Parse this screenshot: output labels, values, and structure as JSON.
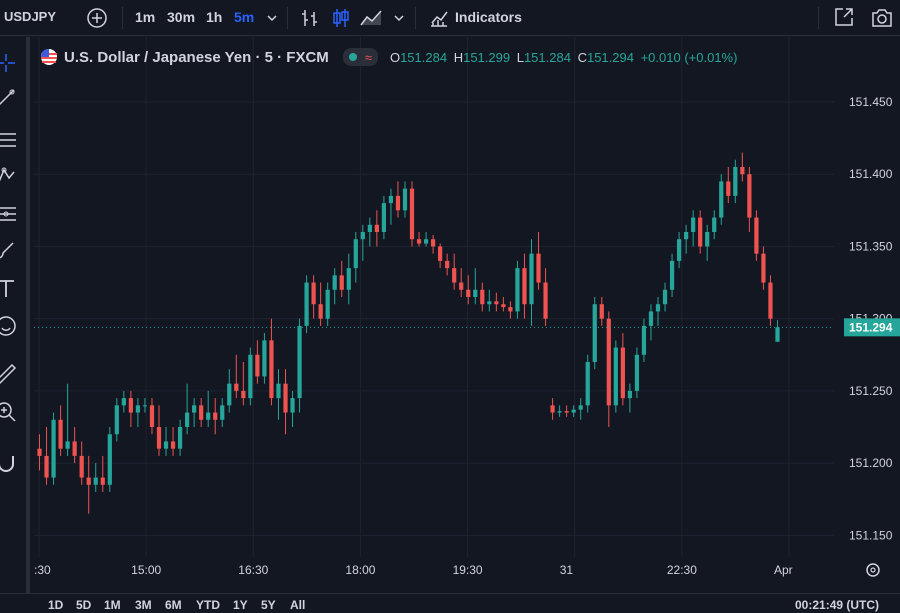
{
  "toolbar": {
    "symbol": "USDJPY",
    "intervals": [
      "1m",
      "30m",
      "1h",
      "5m"
    ],
    "active_interval": "5m",
    "indicators_label": "Indicators"
  },
  "legend": {
    "title": "U.S. Dollar / Japanese Yen · 5 · FXCM",
    "o_label": "O",
    "o_value": "151.284",
    "h_label": "H",
    "h_value": "151.299",
    "l_label": "L",
    "l_value": "151.284",
    "c_label": "C",
    "c_value": "151.294",
    "change": "+0.010 (+0.01%)",
    "status_glyph": "≈"
  },
  "bottom": {
    "ranges": [
      "1D",
      "5D",
      "1M",
      "3M",
      "6M",
      "YTD",
      "1Y",
      "5Y",
      "All"
    ],
    "clock": "00:21:49 (UTC)"
  },
  "colors": {
    "up": "#26a69a",
    "down": "#ef5350",
    "background": "#131722",
    "text": "#d1d4dc",
    "blue": "#2962ff"
  },
  "chart_data": {
    "type": "candlestick",
    "y_ticks": [
      "151.150",
      "151.200",
      "151.250",
      "151.300",
      "151.350",
      "151.400",
      "151.450"
    ],
    "x_ticks": [
      ":30",
      "15:00",
      "16:30",
      "18:00",
      "19:30",
      "31",
      "22:30",
      "Apr"
    ],
    "last_price": "151.294",
    "ylim": [
      151.135,
      151.495
    ],
    "ohlc": [
      [
        151.21,
        151.22,
        151.195,
        151.205
      ],
      [
        151.205,
        151.225,
        151.185,
        151.19
      ],
      [
        151.19,
        151.235,
        151.185,
        151.23
      ],
      [
        151.23,
        151.24,
        151.205,
        151.21
      ],
      [
        151.21,
        151.255,
        151.205,
        151.215
      ],
      [
        151.215,
        151.225,
        151.2,
        151.205
      ],
      [
        151.205,
        151.215,
        151.185,
        151.19
      ],
      [
        151.19,
        151.205,
        151.165,
        151.185
      ],
      [
        151.185,
        151.2,
        151.18,
        151.19
      ],
      [
        151.19,
        151.205,
        151.18,
        151.185
      ],
      [
        151.185,
        151.225,
        151.18,
        151.22
      ],
      [
        151.22,
        151.245,
        151.215,
        151.24
      ],
      [
        151.24,
        151.25,
        151.235,
        151.245
      ],
      [
        151.245,
        151.25,
        151.225,
        151.235
      ],
      [
        151.235,
        151.245,
        151.225,
        151.24
      ],
      [
        151.24,
        151.245,
        151.235,
        151.24
      ],
      [
        151.24,
        151.245,
        151.22,
        151.225
      ],
      [
        151.225,
        151.24,
        151.205,
        151.21
      ],
      [
        151.21,
        151.225,
        151.205,
        151.215
      ],
      [
        151.215,
        151.225,
        151.205,
        151.21
      ],
      [
        151.21,
        151.23,
        151.205,
        151.225
      ],
      [
        151.225,
        151.255,
        151.22,
        151.235
      ],
      [
        151.235,
        151.245,
        151.225,
        151.24
      ],
      [
        151.24,
        151.245,
        151.225,
        151.23
      ],
      [
        151.23,
        151.25,
        151.225,
        151.235
      ],
      [
        151.235,
        151.245,
        151.22,
        151.23
      ],
      [
        151.23,
        151.245,
        151.225,
        151.24
      ],
      [
        151.24,
        151.265,
        151.235,
        151.255
      ],
      [
        151.255,
        151.275,
        151.245,
        151.25
      ],
      [
        151.25,
        151.27,
        151.24,
        151.245
      ],
      [
        151.245,
        151.28,
        151.24,
        151.275
      ],
      [
        151.275,
        151.285,
        151.255,
        151.26
      ],
      [
        151.26,
        151.29,
        151.255,
        151.285
      ],
      [
        151.285,
        151.3,
        151.24,
        151.245
      ],
      [
        151.245,
        151.265,
        151.23,
        151.255
      ],
      [
        151.255,
        151.265,
        151.22,
        151.235
      ],
      [
        151.235,
        151.25,
        151.225,
        151.245
      ],
      [
        151.245,
        151.3,
        151.235,
        151.295
      ],
      [
        151.295,
        151.33,
        151.29,
        151.325
      ],
      [
        151.325,
        151.33,
        151.3,
        151.31
      ],
      [
        151.31,
        151.325,
        151.295,
        151.3
      ],
      [
        151.3,
        151.325,
        151.295,
        151.32
      ],
      [
        151.32,
        151.335,
        151.31,
        151.33
      ],
      [
        151.33,
        151.34,
        151.315,
        151.32
      ],
      [
        151.32,
        151.345,
        151.31,
        151.335
      ],
      [
        151.335,
        151.36,
        151.325,
        151.355
      ],
      [
        151.355,
        151.365,
        151.34,
        151.36
      ],
      [
        151.36,
        151.37,
        151.35,
        151.365
      ],
      [
        151.365,
        151.375,
        151.35,
        151.36
      ],
      [
        151.36,
        151.385,
        151.355,
        151.38
      ],
      [
        151.38,
        151.39,
        151.365,
        151.385
      ],
      [
        151.385,
        151.395,
        151.37,
        151.375
      ],
      [
        151.375,
        151.395,
        151.37,
        151.39
      ],
      [
        151.39,
        151.395,
        151.35,
        151.355
      ],
      [
        151.355,
        151.36,
        151.35,
        151.352
      ],
      [
        151.352,
        151.36,
        151.35,
        151.355
      ],
      [
        151.355,
        151.358,
        151.345,
        151.35
      ],
      [
        151.35,
        151.352,
        151.335,
        151.34
      ],
      [
        151.34,
        151.345,
        151.33,
        151.335
      ],
      [
        151.335,
        151.345,
        151.32,
        151.325
      ],
      [
        151.325,
        151.335,
        151.315,
        151.32
      ],
      [
        151.32,
        151.33,
        151.31,
        151.315
      ],
      [
        151.315,
        151.335,
        151.31,
        151.32
      ],
      [
        151.32,
        151.325,
        151.305,
        151.31
      ],
      [
        151.31,
        151.32,
        151.305,
        151.312
      ],
      [
        151.312,
        151.318,
        151.305,
        151.31
      ],
      [
        151.31,
        151.315,
        151.305,
        151.308
      ],
      [
        151.308,
        151.312,
        151.3,
        151.305
      ],
      [
        151.305,
        151.34,
        151.3,
        151.335
      ],
      [
        151.335,
        151.345,
        151.3,
        151.31
      ],
      [
        151.31,
        151.355,
        151.295,
        151.345
      ],
      [
        151.345,
        151.36,
        151.32,
        151.325
      ],
      [
        151.325,
        151.335,
        151.295,
        151.3
      ],
      [
        151.24,
        151.245,
        151.23,
        151.235
      ],
      [
        151.235,
        151.24,
        151.232,
        151.236
      ],
      [
        151.236,
        151.24,
        151.232,
        151.235
      ],
      [
        151.235,
        151.24,
        151.232,
        151.237
      ],
      [
        151.237,
        151.245,
        151.23,
        151.24
      ],
      [
        151.24,
        151.275,
        151.235,
        151.27
      ],
      [
        151.27,
        151.315,
        151.265,
        151.31
      ],
      [
        151.31,
        151.315,
        151.295,
        151.3
      ],
      [
        151.3,
        151.305,
        151.225,
        151.24
      ],
      [
        151.24,
        151.285,
        151.235,
        151.28
      ],
      [
        151.28,
        151.29,
        151.24,
        151.245
      ],
      [
        151.245,
        151.255,
        151.235,
        151.25
      ],
      [
        151.25,
        151.28,
        151.245,
        151.275
      ],
      [
        151.275,
        151.3,
        151.27,
        151.295
      ],
      [
        151.295,
        151.31,
        151.285,
        151.305
      ],
      [
        151.305,
        151.315,
        151.295,
        151.31
      ],
      [
        151.31,
        151.325,
        151.305,
        151.32
      ],
      [
        151.32,
        151.345,
        151.315,
        151.34
      ],
      [
        151.34,
        151.36,
        151.335,
        151.355
      ],
      [
        151.355,
        151.365,
        151.345,
        151.36
      ],
      [
        151.36,
        151.375,
        151.35,
        151.37
      ],
      [
        151.37,
        151.375,
        151.345,
        151.35
      ],
      [
        151.35,
        151.365,
        151.34,
        151.36
      ],
      [
        151.36,
        151.375,
        151.355,
        151.37
      ],
      [
        151.37,
        151.4,
        151.365,
        151.395
      ],
      [
        151.395,
        151.405,
        151.38,
        151.385
      ],
      [
        151.385,
        151.41,
        151.38,
        151.405
      ],
      [
        151.405,
        151.415,
        151.395,
        151.4
      ],
      [
        151.4,
        151.405,
        151.36,
        151.37
      ],
      [
        151.37,
        151.375,
        151.34,
        151.345
      ],
      [
        151.345,
        151.35,
        151.32,
        151.325
      ],
      [
        151.325,
        151.33,
        151.295,
        151.3
      ],
      [
        151.284,
        151.299,
        151.284,
        151.294
      ]
    ]
  }
}
